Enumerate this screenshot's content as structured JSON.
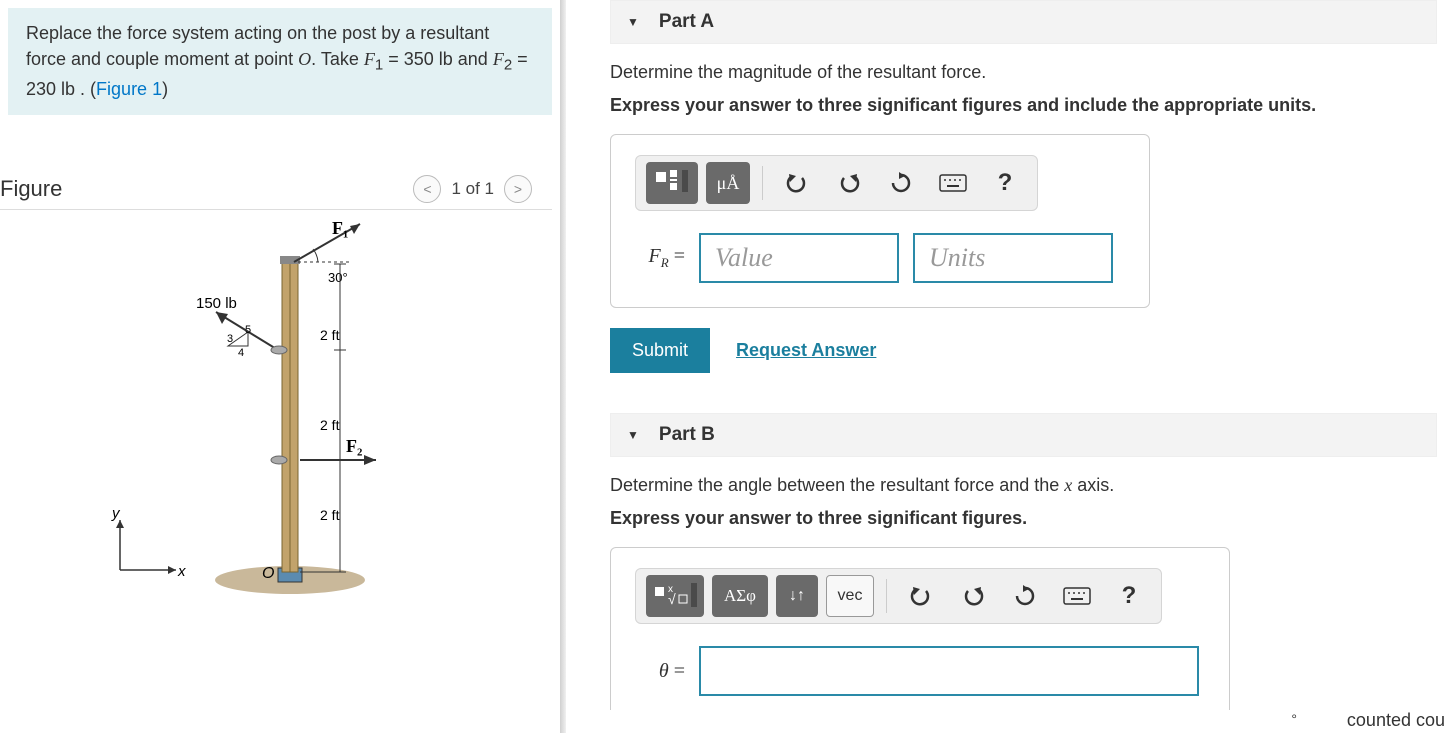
{
  "prompt": {
    "line1_a": "Replace the force system acting on the post by a resultant force and couple moment at point ",
    "pointO": "O",
    "line1_b": ". Take ",
    "F1var": "F",
    "F1sub": "1",
    "eq1": " = 350 lb and ",
    "F2var": "F",
    "F2sub": "2",
    "eq2": " = 230 lb . (",
    "figureLinkText": "Figure 1",
    "close": ")"
  },
  "figure": {
    "title": "Figure",
    "counter": "1 of 1",
    "labels": {
      "F1": "F₁",
      "F2": "F₂",
      "angle30": "30°",
      "force150": "150 lb",
      "d3": "3",
      "d5": "5",
      "d4": "4",
      "ft2a": "2 ft",
      "ft2b": "2 ft",
      "ft2c": "2 ft",
      "O": "O",
      "x": "x",
      "y": "y"
    }
  },
  "partA": {
    "header": "Part A",
    "question": "Determine the magnitude of the resultant force.",
    "instruction": "Express your answer to three significant figures and include the appropriate units.",
    "toolbar": {
      "units_mu": "μÅ",
      "help": "?"
    },
    "varLabel": "F",
    "varSub": "R",
    "equals": " =",
    "valuePlaceholder": "Value",
    "unitsPlaceholder": "Units",
    "submit": "Submit",
    "request": "Request Answer"
  },
  "partB": {
    "header": "Part B",
    "question_a": "Determine the angle between the resultant force and the ",
    "question_x": "x",
    "question_b": " axis.",
    "instruction": "Express your answer to three significant figures.",
    "toolbar": {
      "asf": "ΑΣφ",
      "updown": "↓↑",
      "vec": "vec",
      "help": "?"
    },
    "varLabel": "θ",
    "equals": " ="
  },
  "footer": {
    "counted": "counted cou",
    "deg": "°"
  }
}
